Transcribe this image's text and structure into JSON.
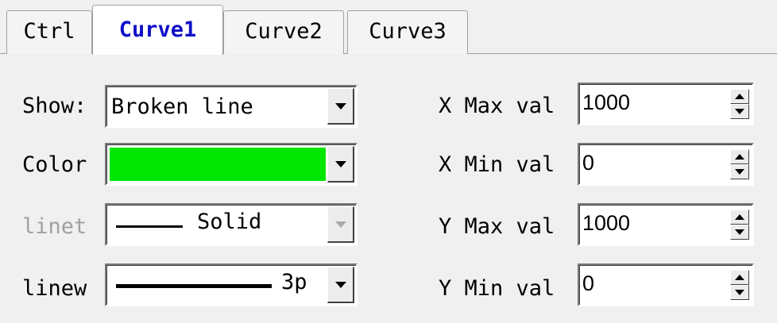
{
  "tabs": [
    {
      "label": "Ctrl",
      "active": false
    },
    {
      "label": "Curve1",
      "active": true
    },
    {
      "label": "Curve2",
      "active": false
    },
    {
      "label": "Curve3",
      "active": false
    }
  ],
  "form": {
    "show": {
      "label": "Show:",
      "value": "Broken line"
    },
    "color": {
      "label": "Color",
      "value_color": "#00e600"
    },
    "linetype": {
      "label": "linet",
      "value": "Solid",
      "disabled": true
    },
    "linewidth": {
      "label": "linew",
      "value": "3p"
    },
    "xmax": {
      "label": "X Max val",
      "value": "1000"
    },
    "xmin": {
      "label": "X Min val",
      "value": "0"
    },
    "ymax": {
      "label": "Y Max val",
      "value": "1000"
    },
    "ymin": {
      "label": "Y Min val",
      "value": "0"
    }
  },
  "colors": {
    "active_tab_text": "#1010c8",
    "disabled_text": "#a0a0a0"
  },
  "icons": {
    "dropdown": "chevron-down-icon",
    "spinner": "spin-arrows-icon"
  }
}
